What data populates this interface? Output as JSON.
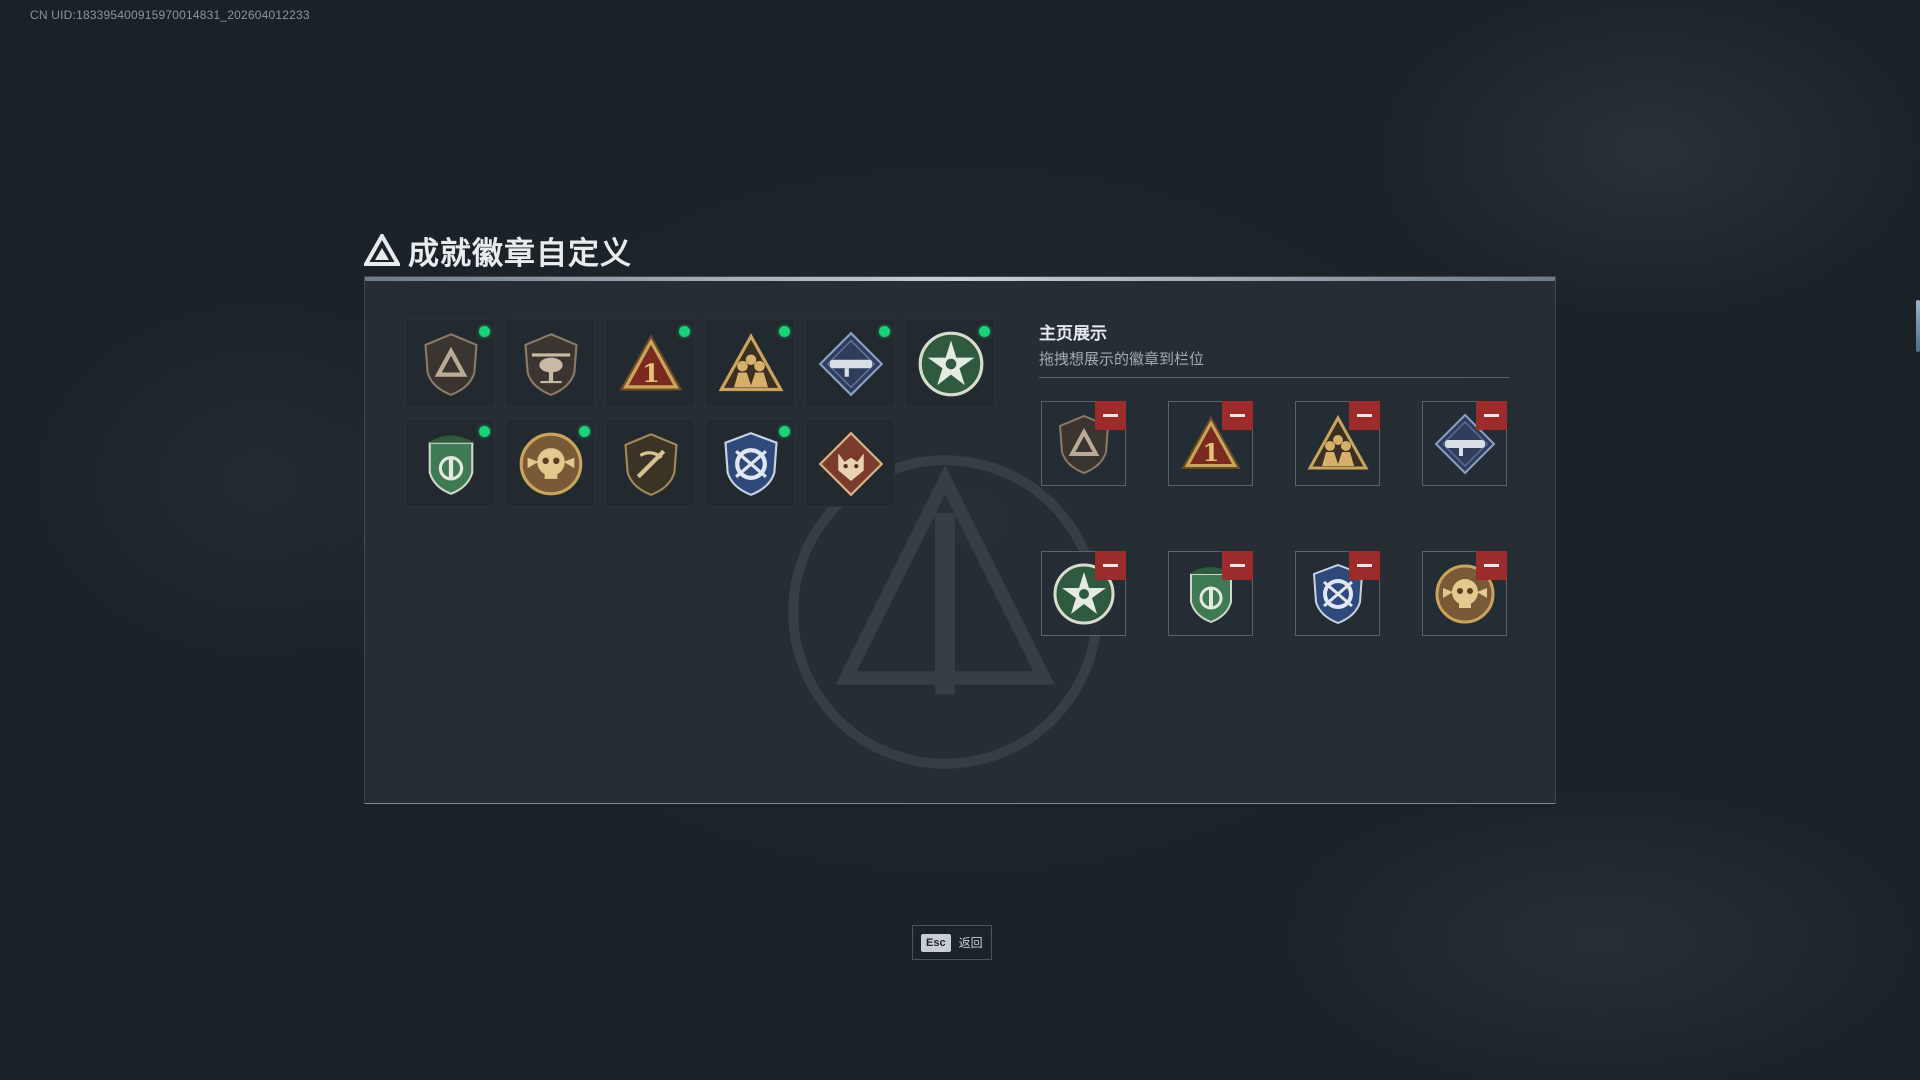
{
  "uid_text": "CN UID:18339540091597001483​1_202604012233",
  "title": "成就徽章自定义",
  "badges": [
    {
      "icon": "shield-triangle-badge-icon",
      "new": true
    },
    {
      "icon": "helicopter-badge-icon",
      "new": false
    },
    {
      "icon": "number-one-triangle-badge-icon",
      "new": true
    },
    {
      "icon": "squad-triangle-badge-icon",
      "new": true
    },
    {
      "icon": "launcher-diamond-badge-icon",
      "new": true
    },
    {
      "icon": "green-star-badge-icon",
      "new": true
    },
    {
      "icon": "green-beret-shield-badge-icon",
      "new": true
    },
    {
      "icon": "skull-medallion-badge-icon",
      "new": true
    },
    {
      "icon": "rifle-shield-badge-icon",
      "new": false
    },
    {
      "icon": "blue-crest-badge-icon",
      "new": true
    },
    {
      "icon": "wolf-diamond-badge-icon",
      "new": false
    }
  ],
  "showcase": {
    "title": "主页展示",
    "subtitle": "拖拽想展示的徽章到栏位",
    "slots": [
      "shield-triangle-badge-icon",
      "number-one-triangle-badge-icon",
      "squad-triangle-badge-icon",
      "launcher-diamond-badge-icon",
      "green-star-badge-icon",
      "green-beret-shield-badge-icon",
      "blue-crest-badge-icon",
      "skull-medallion-badge-icon"
    ]
  },
  "footer": {
    "key": "Esc",
    "label": "返回"
  },
  "colors": {
    "new_dot": "#19d27a",
    "remove": "#9c2c2c",
    "gold": "#c9a45c",
    "green": "#3f7a55",
    "blue": "#3c5a8a"
  }
}
